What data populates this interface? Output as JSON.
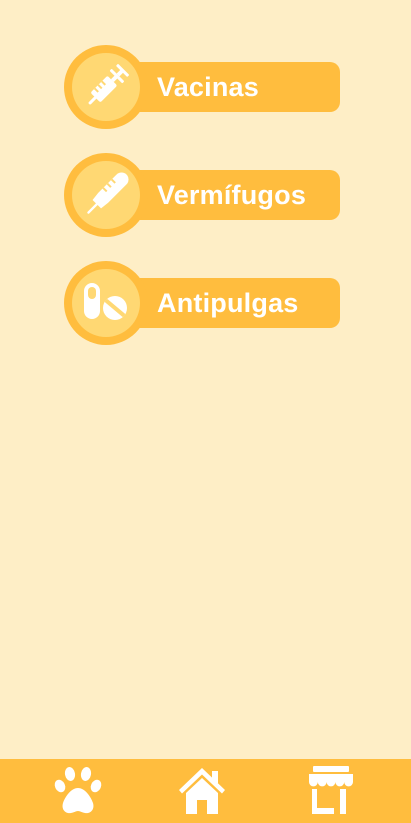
{
  "menu": {
    "items": [
      {
        "label": "Vacinas",
        "icon": "syringe-icon"
      },
      {
        "label": "Vermífugos",
        "icon": "dropper-icon"
      },
      {
        "label": "Antipulgas",
        "icon": "pills-icon"
      }
    ]
  },
  "bottom_nav": {
    "items": [
      {
        "icon": "paw-icon"
      },
      {
        "icon": "home-icon"
      },
      {
        "icon": "store-icon"
      }
    ]
  },
  "colors": {
    "background": "#FEEEC6",
    "accent": "#FFBD3E",
    "icon_circle": "#FFD873",
    "text": "#FFFFFF"
  }
}
